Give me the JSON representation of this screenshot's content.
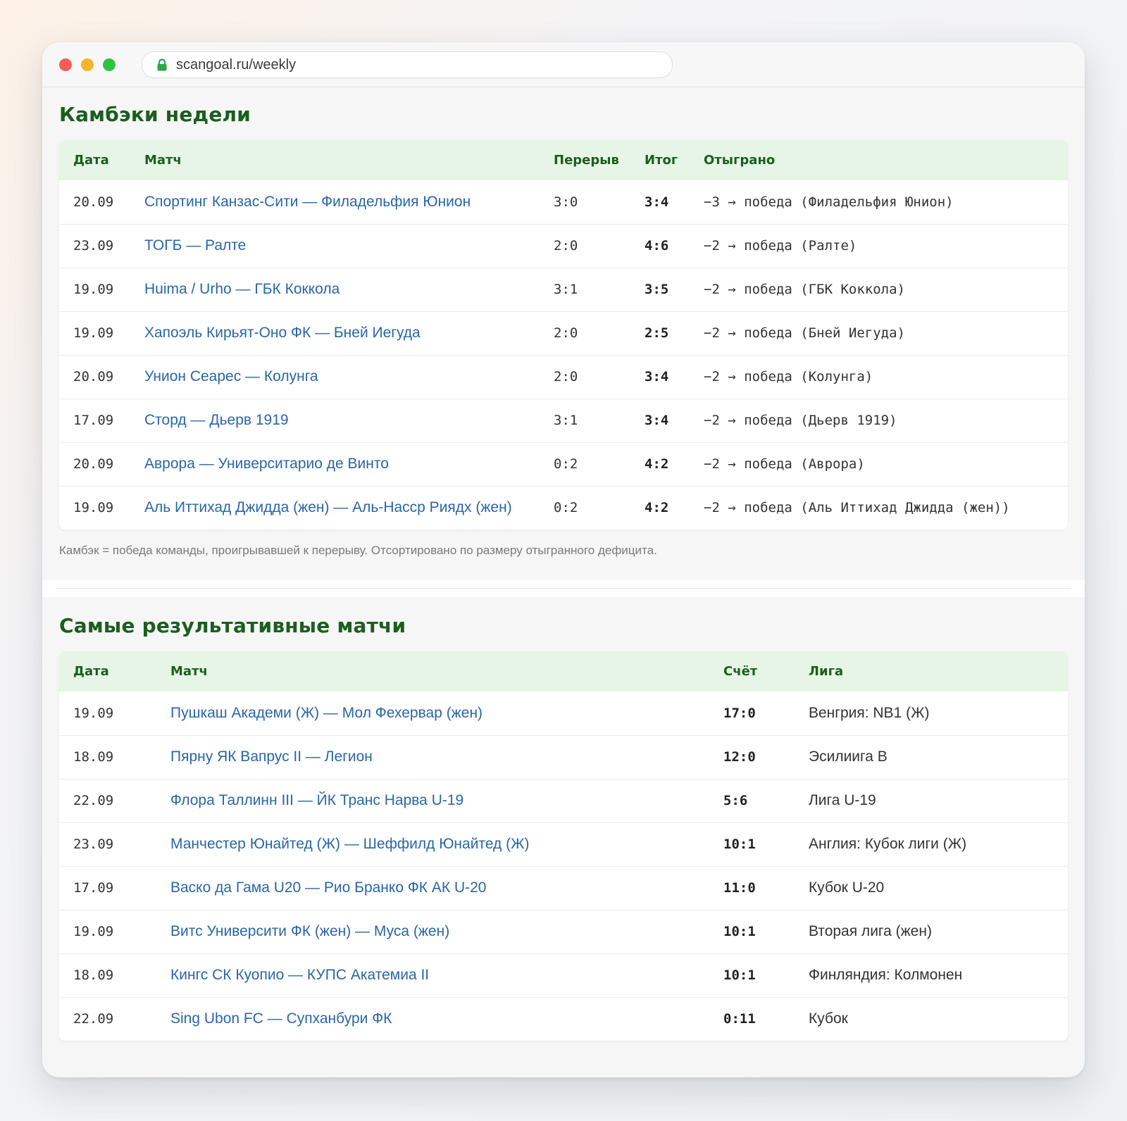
{
  "browser": {
    "url": "scangoal.ru/weekly"
  },
  "comebacks": {
    "title": "Камбэки недели",
    "headers": [
      "Дата",
      "Матч",
      "Перерыв",
      "Итог",
      "Отыграно"
    ],
    "rows": [
      [
        "20.09",
        "Спортинг Канзас-Сити — Филадельфия Юнион",
        "3:0",
        "3:4",
        "−3 → победа (Филадельфия Юнион)"
      ],
      [
        "23.09",
        "ТОГБ — Ралте",
        "2:0",
        "4:6",
        "−2 → победа (Ралте)"
      ],
      [
        "19.09",
        "Huima / Urho — ГБК Коккола",
        "3:1",
        "3:5",
        "−2 → победа (ГБК Коккола)"
      ],
      [
        "19.09",
        "Хапоэль Кирьят-Оно ФК — Бней Иегуда",
        "2:0",
        "2:5",
        "−2 → победа (Бней Иегуда)"
      ],
      [
        "20.09",
        "Унион Сеарес — Колунга",
        "2:0",
        "3:4",
        "−2 → победа (Колунга)"
      ],
      [
        "17.09",
        "Сторд — Дьерв 1919",
        "3:1",
        "3:4",
        "−2 → победа (Дьерв 1919)"
      ],
      [
        "20.09",
        "Аврора — Университарио де Винто",
        "0:2",
        "4:2",
        "−2 → победа (Аврора)"
      ],
      [
        "19.09",
        "Аль Иттихад Джидда (жен) — Аль-Насср Риядх (жен)",
        "0:2",
        "4:2",
        "−2 → победа (Аль Иттихад Джидда (жен))"
      ]
    ],
    "note": "Камбэк = победа команды, проигрывавшей к перерыву. Отсортировано по размеру отыгранного дефицита."
  },
  "topscoring": {
    "title": "Самые результативные матчи",
    "headers": [
      "Дата",
      "Матч",
      "Счёт",
      "Лига"
    ],
    "rows": [
      [
        "19.09",
        "Пушкаш Академи (Ж) — Мол Фехервар (жен)",
        "17:0",
        "Венгрия: NB1 (Ж)"
      ],
      [
        "18.09",
        "Пярну ЯК Вапрус II — Легион",
        "12:0",
        "Эсилиига B"
      ],
      [
        "22.09",
        "Флора Таллинн III — ЙК Транс Нарва U-19",
        "5:6",
        "Лига U-19"
      ],
      [
        "23.09",
        "Манчестер Юнайтед (Ж) — Шеффилд Юнайтед (Ж)",
        "10:1",
        "Англия: Кубок лиги (Ж)"
      ],
      [
        "17.09",
        "Васко да Гама U20 — Рио Бранко ФК АК U-20",
        "11:0",
        "Кубок U-20"
      ],
      [
        "19.09",
        "Витс Университи ФК (жен) — Муса (жен)",
        "10:1",
        "Вторая лига (жен)"
      ],
      [
        "18.09",
        "Кингс СК Куопио — КУПС Акатемиа II",
        "10:1",
        "Финляндия: Колмонен"
      ],
      [
        "22.09",
        "Sing Ubon FC — Супханбури ФК",
        "0:11",
        "Кубок"
      ]
    ]
  }
}
